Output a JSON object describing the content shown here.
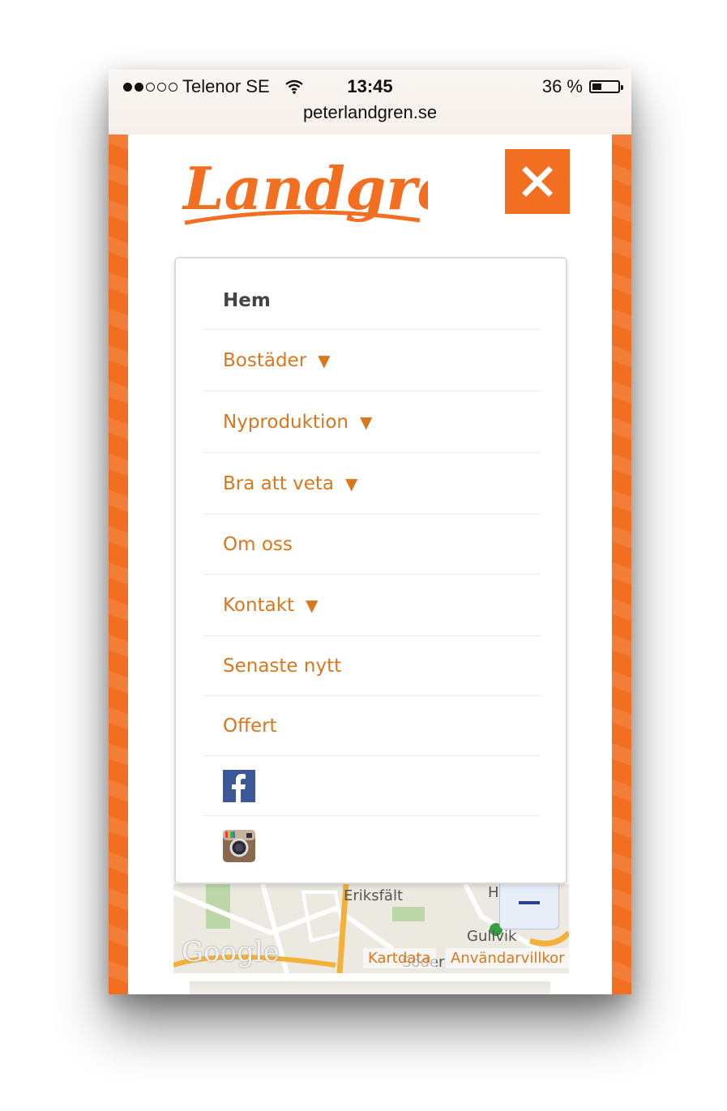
{
  "status_bar": {
    "carrier": "Telenor SE",
    "time": "13:45",
    "battery": "36 %",
    "battery_level": 0.36,
    "signal_bars": 2,
    "signal_total": 5
  },
  "browser": {
    "url": "peterlandgren.se"
  },
  "header": {
    "logo_text": "Landgren",
    "close_icon": "close-x-icon",
    "accent_color": "#f26f21"
  },
  "menu": {
    "items": [
      {
        "label": "Hem",
        "arrow": "",
        "active": true
      },
      {
        "label": "Bostäder",
        "arrow": "▼",
        "active": false
      },
      {
        "label": "Nyproduktion",
        "arrow": "▼",
        "active": false
      },
      {
        "label": "Bra att veta",
        "arrow": "▼",
        "active": false
      },
      {
        "label": "Om oss",
        "arrow": "",
        "active": false
      },
      {
        "label": "Kontakt",
        "arrow": "▼",
        "active": false
      },
      {
        "label": "Senaste nytt",
        "arrow": "",
        "active": false
      },
      {
        "label": "Offert",
        "arrow": "",
        "active": false
      }
    ],
    "social": [
      {
        "icon": "facebook-icon"
      },
      {
        "icon": "instagram-icon"
      }
    ]
  },
  "map": {
    "labels": [
      "Eriksfält",
      "Gullvik",
      "Söder",
      "H"
    ],
    "watermark": "Google",
    "kartdata": "Kartdata",
    "terms": "Användarvillkor",
    "zoom_out": "−"
  }
}
